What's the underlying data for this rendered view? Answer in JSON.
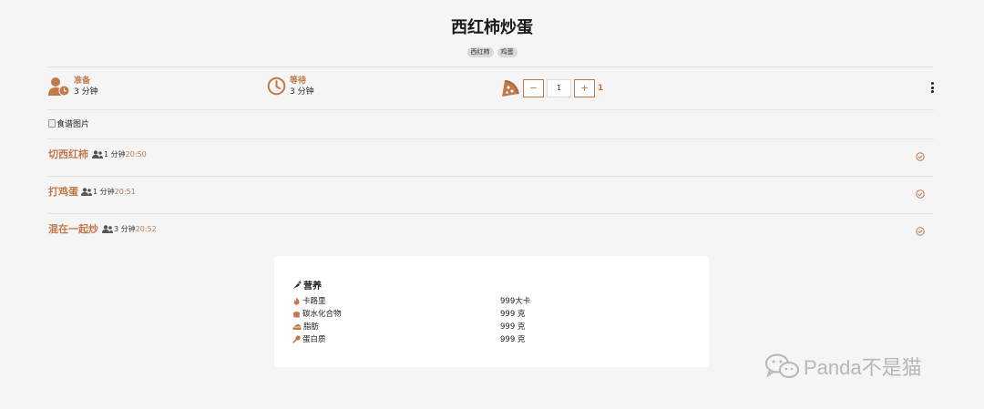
{
  "recipe": {
    "title": "西红柿炒蛋",
    "tags": [
      "西红柿",
      "鸡蛋"
    ],
    "image_alt": "食谱图片"
  },
  "meta": {
    "prep_label": "准备",
    "prep_value": "3 分钟",
    "wait_label": "等待",
    "wait_value": "3 分钟"
  },
  "servings": {
    "minus": "−",
    "value": "1",
    "plus": "+",
    "count": "1"
  },
  "steps": [
    {
      "name": "切西红柿",
      "duration": "1 分钟",
      "time": "20:50"
    },
    {
      "name": "打鸡蛋",
      "duration": "1 分钟",
      "time": "20:51"
    },
    {
      "name": "混在一起炒",
      "duration": "3 分钟",
      "time": "20:52"
    }
  ],
  "nutrition": {
    "title": "营养",
    "rows": [
      {
        "label": "卡路里",
        "value": "999大卡",
        "icon": "fire-icon"
      },
      {
        "label": "碳水化合物",
        "value": "999 克",
        "icon": "bread-icon"
      },
      {
        "label": "脂肪",
        "value": "999 克",
        "icon": "cheese-icon"
      },
      {
        "label": "蛋白质",
        "value": "999 克",
        "icon": "drumstick-icon"
      }
    ]
  },
  "watermark": {
    "text": "Panda不是猫"
  },
  "colors": {
    "accent": "#c07a4a",
    "background": "#f5f5f5"
  }
}
